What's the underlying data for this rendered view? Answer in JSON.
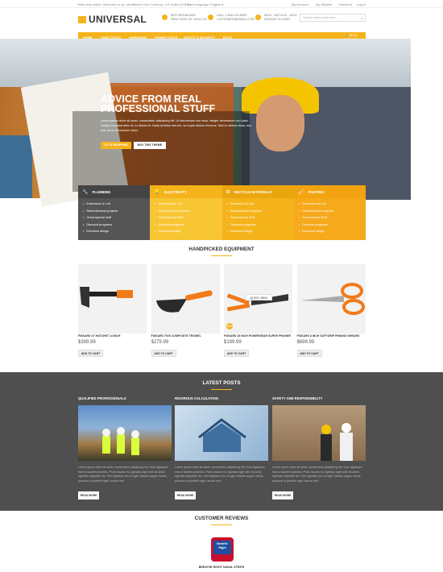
{
  "topbar": {
    "welcome": "Hello dear visitor. Welcome to our store!",
    "currency": "Select Your Currency: US Dollar (USD) ▾",
    "language": "Your Language: English ▾",
    "account": "My Account",
    "wishlist": "My Wishlist",
    "checkout": "Checkout",
    "login": "Log in"
  },
  "header": {
    "logo": "UNIVERSAL",
    "address_l1": "9870 BROADWAY",
    "address_l2": "NEW YORK NY 10010 US",
    "phone_l1": "CALL 1-800-123-5690",
    "phone_l2": "CUSTOMER@EMAIL.COM",
    "hours_l1": "MON - SAT 8:00 - 18:00",
    "hours_l2": "SUNDAY CLOSED",
    "search_placeholder": "Search entire store here..."
  },
  "nav": {
    "items": [
      "HOME",
      "HAND TOOLS",
      "HARDWARE",
      "POWER TOOLS",
      "SAFETY & SECURITY",
      "BLOG"
    ],
    "cart_total": "$0.00",
    "cart_items": "0 ITEMS"
  },
  "hero": {
    "title": "ADVICE FROM REAL PROFESSIONAL STUFF",
    "text": "Lorem ipsum dolor sit amet, consectetur adipiscing elit. Ut elementum nisl risus, integer elementum orci justo. Nullam tincidunt ante mi, in dictum et. Nulla at tellus sed dui, ac turpis dictum rhoncus. Sed ut ultrices dolor, non sed, proin elementum dolor.",
    "btn1": "LET'S SHOPPING",
    "btn2": "BUY THIS THEME"
  },
  "categories": [
    {
      "title": "PLUMBING",
      "icon": "wrench-icon",
      "color": "#555555",
      "items": [
        "Extensions & Loft",
        "Refurbishment projects",
        "Great special stuff",
        "Discount programs",
        "Electrical design"
      ]
    },
    {
      "title": "ELECTRICITY",
      "icon": "lightbulb-icon",
      "color": "#f8c533",
      "items": [
        "Extensions & Loft",
        "Refurbishment projects",
        "Great special stuff",
        "Discount programs",
        "Electrical design"
      ]
    },
    {
      "title": "RECYCLE MATERIALS",
      "icon": "recycle-icon",
      "color": "#f5b31b",
      "items": [
        "Extensions & Loft",
        "Refurbishment projects",
        "Great special stuff",
        "Discount programs",
        "Electrical design"
      ]
    },
    {
      "title": "PAINTING",
      "icon": "paintbrush-icon",
      "color": "#f5a91b",
      "items": [
        "Extensions & Loft",
        "Refurbishment projects",
        "Great special stuff",
        "Discount programs",
        "Electrical design"
      ]
    }
  ],
  "equipment": {
    "title": "HANDPICKED EQUIPMENT",
    "quick_view": "QUICK VIEW",
    "badge": "New",
    "products": [
      {
        "name": "FISKARS X7 HATCHET 14 INCH",
        "price": "$399.99",
        "btn": "ADD TO CART"
      },
      {
        "name": "FISKARS 7978 COMPOSITE TROWEL",
        "price": "$279.99",
        "btn": "ADD TO CART"
      },
      {
        "name": "FISKARS 15 INCH POWERGEAR SUPER PRUNER",
        "price": "$199.99",
        "btn": "ADD TO CART"
      },
      {
        "name": "FISKARS 8 INCH SOFTGRIP PINKING SHEARS",
        "price": "$699.99",
        "btn": "ADD TO CART"
      }
    ]
  },
  "posts": {
    "title": "LATEST POSTS",
    "items": [
      {
        "title": "QUALIFIED PROFESSIONALS",
        "body": "Lorem ipsum dolor sit amet, consectetur adipiscing elit. Duis dignissim erat ut laoreet pharetra. Proin mauris mi, egestas eget nibh sit amet, egestas vulputate dui. Sed egestas non ut eget. Mauris augue metus, posuere ut porttitor eget, auctor sed.",
        "more": "READ MORE"
      },
      {
        "title": "RIGOROUS CALCULATION",
        "body": "Lorem ipsum dolor sit amet, consectetur adipiscing elit. Duis dignissim erat ut laoreet pharetra. Proin mauris mi, egestas eget nibh sit amet, egestas vulputate dui. Sed egestas non ut eget. Mauris augue metus, posuere ut porttitor eget, auctor sed.",
        "more": "READ MORE"
      },
      {
        "title": "SAFETY AND RESPONSIBILITY",
        "body": "Lorem ipsum dolor sit amet, consectetur adipiscing elit. Duis dignissim erat ut laoreet pharetra. Proin mauris mi, egestas eget nibh sit amet, egestas vulputate dui. Sed egestas non ut eget. Mauris augue metus, posuere ut porttitor eget, auctor sed.",
        "more": "READ MORE"
      }
    ]
  },
  "reviews": {
    "title": "CUSTOMER REVIEWS",
    "brand_logo_text": "Breathe Right",
    "product": "BREATHE RIGHT NASAL STRIPS"
  },
  "colors": {
    "accent": "#f5b31b",
    "dark": "#4f4f4f"
  }
}
